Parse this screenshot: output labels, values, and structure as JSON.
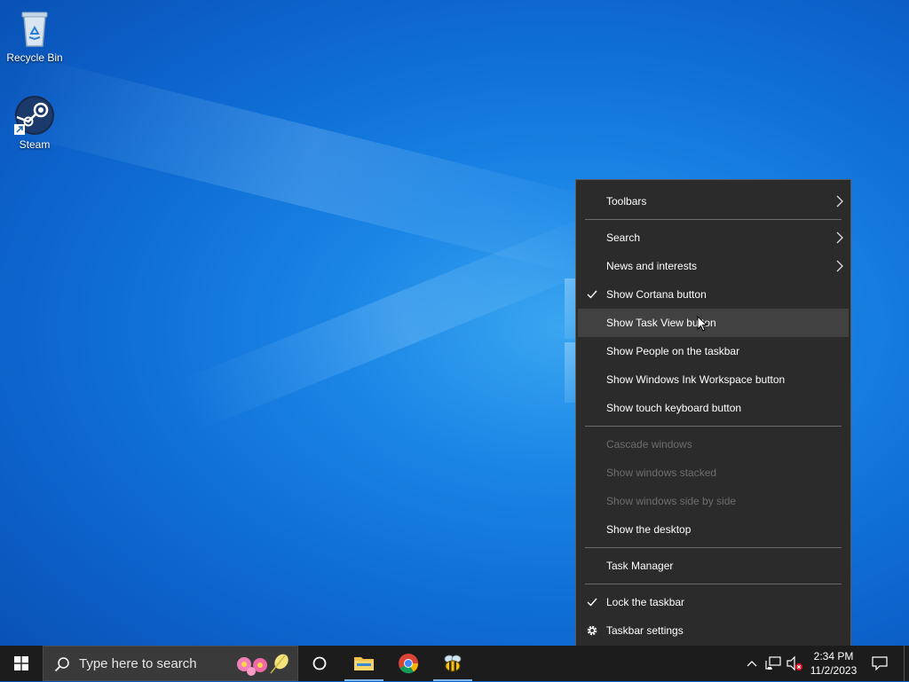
{
  "desktop": {
    "icons": [
      {
        "label": "Recycle Bin",
        "icon": "recycle-bin-icon"
      },
      {
        "label": "Steam",
        "icon": "steam-icon"
      }
    ]
  },
  "context_menu": {
    "items": {
      "toolbars": "Toolbars",
      "search": "Search",
      "news": "News and interests",
      "cortana": "Show Cortana button",
      "taskview": "Show Task View button",
      "people": "Show People on the taskbar",
      "ink": "Show Windows Ink Workspace button",
      "keyboard": "Show touch keyboard button",
      "cascade": "Cascade windows",
      "stacked": "Show windows stacked",
      "sidebyside": "Show windows side by side",
      "desktop": "Show the desktop",
      "taskmanager": "Task Manager",
      "lock": "Lock the taskbar",
      "settings": "Taskbar settings"
    },
    "checked": [
      "Show Cortana button",
      "Lock the taskbar"
    ],
    "disabled": [
      "Cascade windows",
      "Show windows stacked",
      "Show windows side by side"
    ],
    "highlighted": "Show Task View button"
  },
  "taskbar": {
    "search_placeholder": "Type here to search",
    "clock_time": "2:34 PM",
    "clock_date": "11/2/2023",
    "pinned": [
      "cortana-circle-icon",
      "file-explorer-icon",
      "chrome-icon",
      "bee-app-icon"
    ]
  },
  "colors": {
    "menu_bg": "#2b2b2b",
    "menu_hover": "#414141",
    "taskbar_bg": "#1c1c1c",
    "desktop_blue": "#1b86e6"
  }
}
